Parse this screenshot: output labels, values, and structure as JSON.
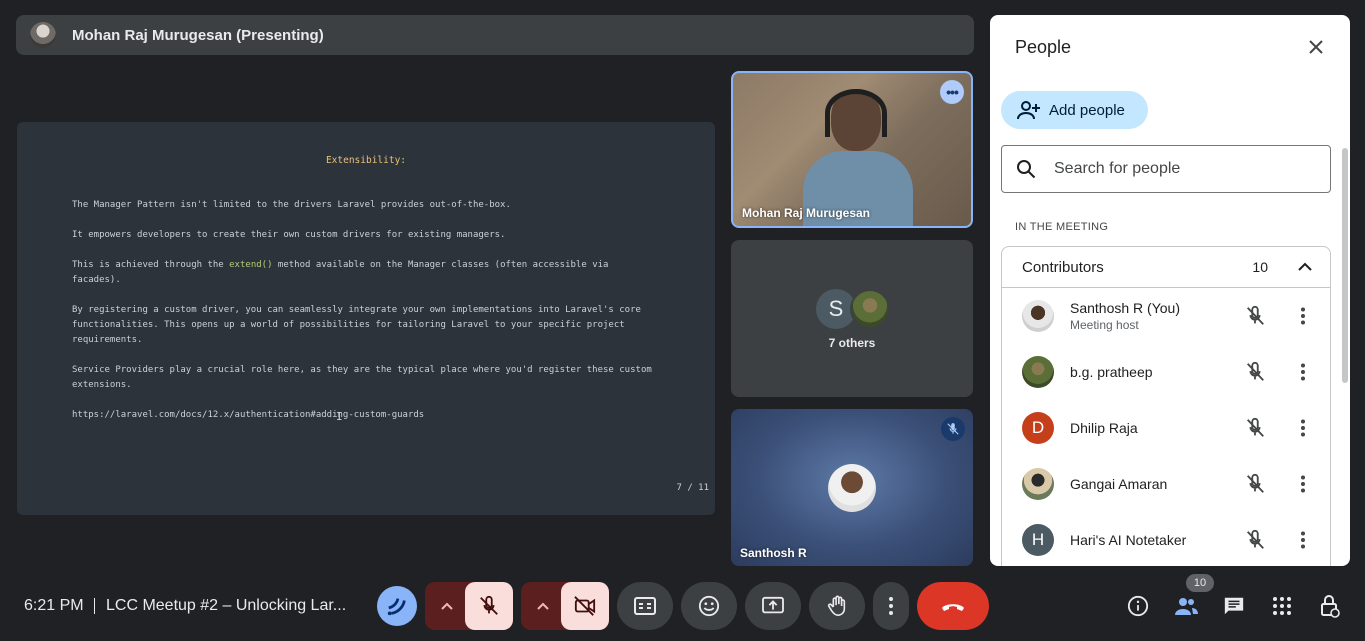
{
  "presenter": {
    "name": "Mohan Raj Murugesan (Presenting)"
  },
  "slide": {
    "title": "Extensibility:",
    "paragraphs": [
      "The Manager Pattern isn't limited to the drivers Laravel provides out-of-the-box.",
      "It empowers developers to create their own custom drivers for existing managers.",
      "By registering a custom driver, you can seamlessly integrate your own implementations into Laravel's core\nfunctionalities. This opens up a world of possibilities for tailoring Laravel to your specific project\nrequirements.",
      "Service Providers play a crucial role here, as they are the typical place where you'd register these custom\nextensions.",
      "https://laravel.com/docs/12.x/authentication#adding-custom-guards"
    ],
    "p3_before": "This is achieved through the ",
    "p3_code": "extend()",
    "p3_after": " method available on the Manager classes (often accessible via facades).",
    "cursor": "I",
    "page": "7 / 11"
  },
  "tiles": {
    "tile1_name": "Mohan Raj Murugesan",
    "tile2_avatar_letter": "S",
    "tile2_label": "7 others",
    "tile3_name": "Santhosh R"
  },
  "panel": {
    "title": "People",
    "add_people": "Add people",
    "search_placeholder": "Search for people",
    "section_label": "IN THE MEETING",
    "group_title": "Contributors",
    "group_count": "10",
    "people": [
      {
        "name": "Santhosh R (You)",
        "sub": "Meeting host",
        "letter": "",
        "color": ""
      },
      {
        "name": "b.g. pratheep",
        "sub": "",
        "letter": "",
        "color": ""
      },
      {
        "name": "Dhilip Raja",
        "sub": "",
        "letter": "D",
        "color": "#c5401a"
      },
      {
        "name": "Gangai Amaran",
        "sub": "",
        "letter": "",
        "color": ""
      },
      {
        "name": "Hari's AI Notetaker",
        "sub": "",
        "letter": "H",
        "color": "#4b5a63"
      }
    ]
  },
  "bottom": {
    "time": "6:21 PM",
    "meeting_title": "LCC Meetup #2 – Unlocking Lar...",
    "people_count": "10"
  },
  "colors": {
    "accent": "#8ab4f8",
    "hangup": "#dc3626",
    "panel_bg": "#ffffff",
    "add_people_bg": "#c2e7ff"
  }
}
